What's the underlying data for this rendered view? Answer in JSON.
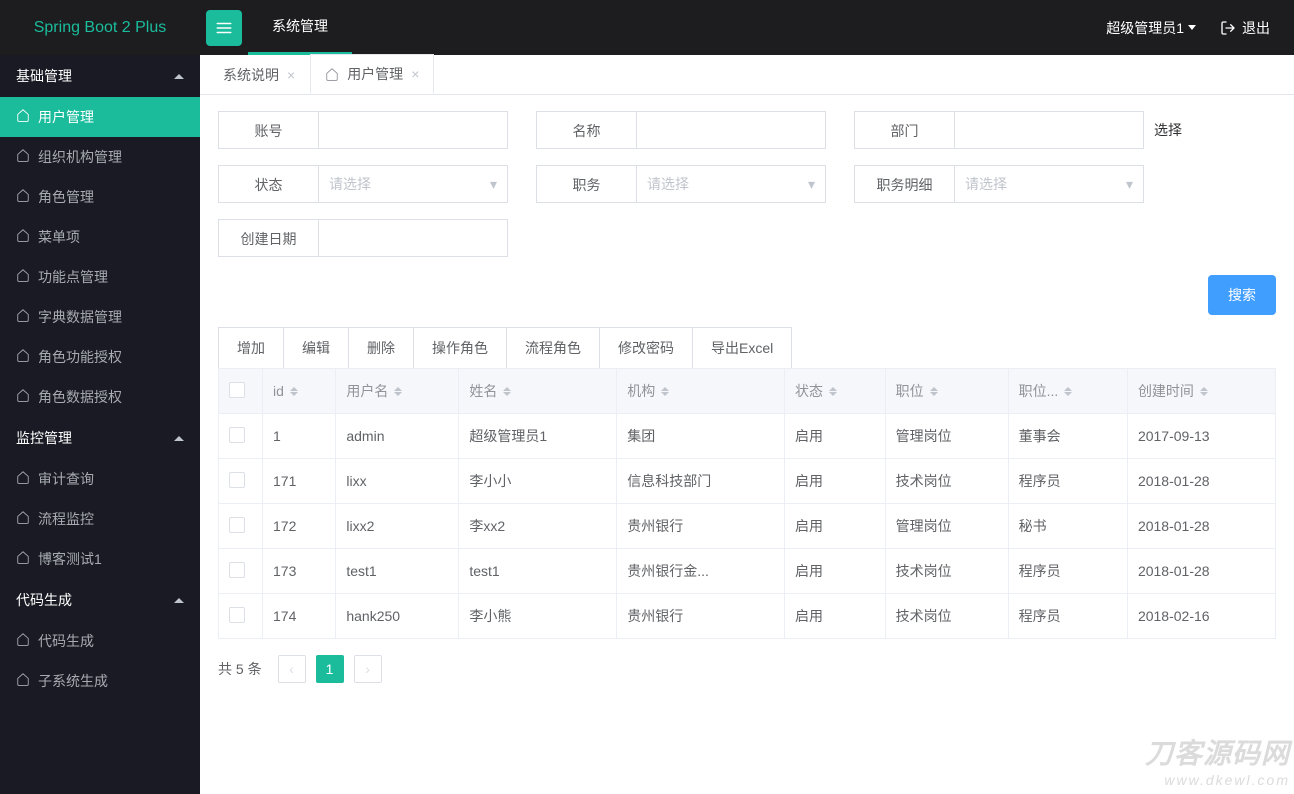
{
  "brand": "Spring Boot 2 Plus",
  "top_tabs": [
    "系统管理"
  ],
  "user": {
    "name": "超级管理员1",
    "logout": "退出"
  },
  "sidebar": {
    "groups": [
      {
        "title": "基础管理",
        "items": [
          "用户管理",
          "组织机构管理",
          "角色管理",
          "菜单项",
          "功能点管理",
          "字典数据管理",
          "角色功能授权",
          "角色数据授权"
        ]
      },
      {
        "title": "监控管理",
        "items": [
          "审计查询",
          "流程监控",
          "博客测试1"
        ]
      },
      {
        "title": "代码生成",
        "items": [
          "代码生成",
          "子系统生成"
        ]
      }
    ]
  },
  "tabs": [
    {
      "label": "系统说明",
      "active": false
    },
    {
      "label": "用户管理",
      "active": true
    }
  ],
  "filters": {
    "account": {
      "label": "账号",
      "value": ""
    },
    "name": {
      "label": "名称",
      "value": ""
    },
    "dept": {
      "label": "部门",
      "value": "",
      "choose": "选择"
    },
    "status": {
      "label": "状态",
      "placeholder": "请选择"
    },
    "position": {
      "label": "职务",
      "placeholder": "请选择"
    },
    "position_detail": {
      "label": "职务明细",
      "placeholder": "请选择"
    },
    "created": {
      "label": "创建日期",
      "value": ""
    }
  },
  "search_btn": "搜索",
  "toolbar": [
    "增加",
    "编辑",
    "删除",
    "操作角色",
    "流程角色",
    "修改密码",
    "导出Excel"
  ],
  "table": {
    "columns": [
      "id",
      "用户名",
      "姓名",
      "机构",
      "状态",
      "职位",
      "职位...",
      "创建时间"
    ],
    "rows": [
      {
        "id": "1",
        "username": "admin",
        "realname": "超级管理员1",
        "org": "集团",
        "status": "启用",
        "pos": "管理岗位",
        "posd": "董事会",
        "created": "2017-09-13"
      },
      {
        "id": "171",
        "username": "lixx",
        "realname": "李小小",
        "org": "信息科技部门",
        "status": "启用",
        "pos": "技术岗位",
        "posd": "程序员",
        "created": "2018-01-28"
      },
      {
        "id": "172",
        "username": "lixx2",
        "realname": "李xx2",
        "org": "贵州银行",
        "status": "启用",
        "pos": "管理岗位",
        "posd": "秘书",
        "created": "2018-01-28"
      },
      {
        "id": "173",
        "username": "test1",
        "realname": "test1",
        "org": "贵州银行金...",
        "status": "启用",
        "pos": "技术岗位",
        "posd": "程序员",
        "created": "2018-01-28"
      },
      {
        "id": "174",
        "username": "hank250",
        "realname": "李小熊",
        "org": "贵州银行",
        "status": "启用",
        "pos": "技术岗位",
        "posd": "程序员",
        "created": "2018-02-16"
      }
    ]
  },
  "pagination": {
    "total_text": "共 5 条",
    "current": "1"
  },
  "watermark": {
    "line1": "刀客源码网",
    "line2": "www.dkewl.com"
  }
}
